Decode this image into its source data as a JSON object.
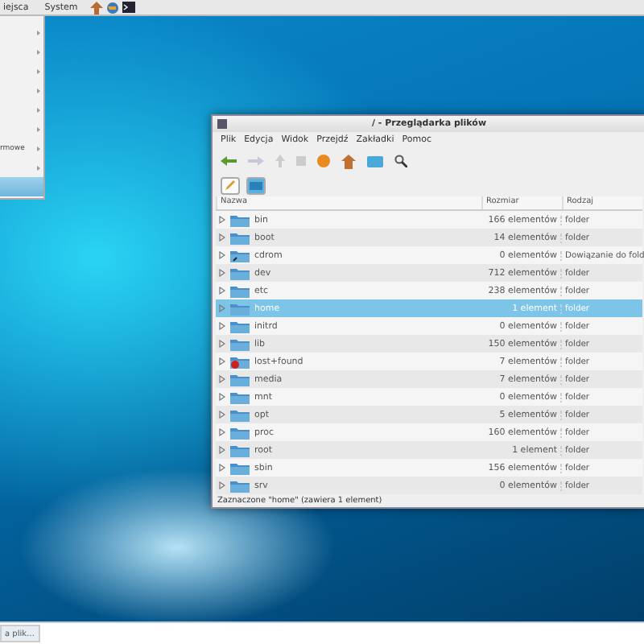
{
  "top_panel": {
    "menus": [
      "iejsca",
      "System"
    ]
  },
  "menu": {
    "items": [
      {
        "has_submenu": true,
        "selected": false
      },
      {
        "has_submenu": true,
        "selected": false
      },
      {
        "has_submenu": true,
        "selected": false
      },
      {
        "has_submenu": true,
        "selected": false
      },
      {
        "has_submenu": true,
        "selected": false
      },
      {
        "has_submenu": true,
        "selected": false
      },
      {
        "label": "rmowe",
        "has_submenu": true,
        "selected": false
      },
      {
        "has_submenu": true,
        "selected": false
      },
      {
        "has_submenu": false,
        "selected": true
      }
    ]
  },
  "window": {
    "title": "/ - Przeglądarka plików",
    "menubar": [
      "Plik",
      "Edycja",
      "Widok",
      "Przejdź",
      "Zakładki",
      "Pomoc"
    ],
    "location_buttons": [
      {
        "kind": "edit",
        "selected": false
      },
      {
        "kind": "path",
        "selected": true
      }
    ],
    "columns": [
      "Nazwa",
      "Rozmiar",
      "Rodzaj"
    ],
    "rows": [
      {
        "name": "bin",
        "size": "166 elementów",
        "type": "folder",
        "kind": "folder",
        "selected": false
      },
      {
        "name": "boot",
        "size": "14 elementów",
        "type": "folder",
        "kind": "folder",
        "selected": false
      },
      {
        "name": "cdrom",
        "size": "0 elementów",
        "type": "Dowiązanie do fold",
        "kind": "link",
        "selected": false
      },
      {
        "name": "dev",
        "size": "712 elementów",
        "type": "folder",
        "kind": "folder",
        "selected": false
      },
      {
        "name": "etc",
        "size": "238 elementów",
        "type": "folder",
        "kind": "folder",
        "selected": false
      },
      {
        "name": "home",
        "size": "1 element",
        "type": "folder",
        "kind": "folder",
        "selected": true
      },
      {
        "name": "initrd",
        "size": "0 elementów",
        "type": "folder",
        "kind": "folder",
        "selected": false
      },
      {
        "name": "lib",
        "size": "150 elementów",
        "type": "folder",
        "kind": "folder",
        "selected": false
      },
      {
        "name": "lost+found",
        "size": "7 elementów",
        "type": "folder",
        "kind": "locked",
        "selected": false
      },
      {
        "name": "media",
        "size": "7 elementów",
        "type": "folder",
        "kind": "folder",
        "selected": false
      },
      {
        "name": "mnt",
        "size": "0 elementów",
        "type": "folder",
        "kind": "folder",
        "selected": false
      },
      {
        "name": "opt",
        "size": "5 elementów",
        "type": "folder",
        "kind": "folder",
        "selected": false
      },
      {
        "name": "proc",
        "size": "160 elementów",
        "type": "folder",
        "kind": "folder",
        "selected": false
      },
      {
        "name": "root",
        "size": "1 element",
        "type": "folder",
        "kind": "folder",
        "selected": false
      },
      {
        "name": "sbin",
        "size": "156 elementów",
        "type": "folder",
        "kind": "folder",
        "selected": false
      },
      {
        "name": "srv",
        "size": "0 elementów",
        "type": "folder",
        "kind": "folder",
        "selected": false
      }
    ],
    "status": "Zaznaczone \"home\" (zawiera 1 element)"
  },
  "taskbar": {
    "buttons": [
      "a plik…"
    ]
  }
}
